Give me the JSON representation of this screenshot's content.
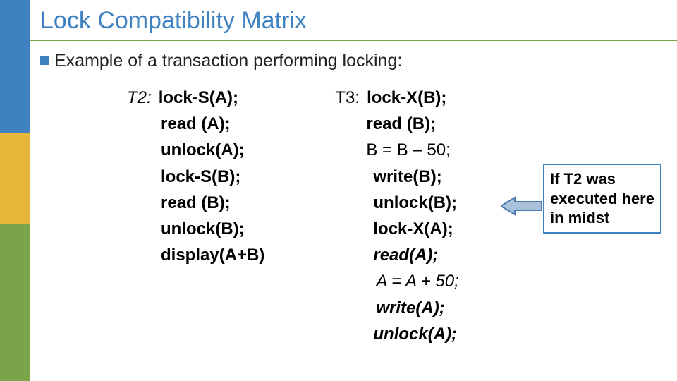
{
  "title": "Lock Compatibility Matrix",
  "bullet": "Example of a transaction performing locking:",
  "t2": {
    "label": "T2:",
    "head": "lock-S(A);",
    "lines": [
      "read (A);",
      "unlock(A);",
      "lock-S(B);",
      "read (B);",
      "unlock(B);",
      "display(A+B)"
    ]
  },
  "t3": {
    "label": "T3:",
    "head": "lock-X(B);",
    "readb": "read (B);",
    "beq": "B = B – 50;",
    "writeb": "write(B);",
    "unlockb": "unlock(B);",
    "lockxa": "lock-X(A);",
    "reada": "read(A);",
    "aeq": "A = A + 50;",
    "writea": "write(A);",
    "unlocka": "unlock(A);"
  },
  "note": "If T2 was executed here in midst"
}
